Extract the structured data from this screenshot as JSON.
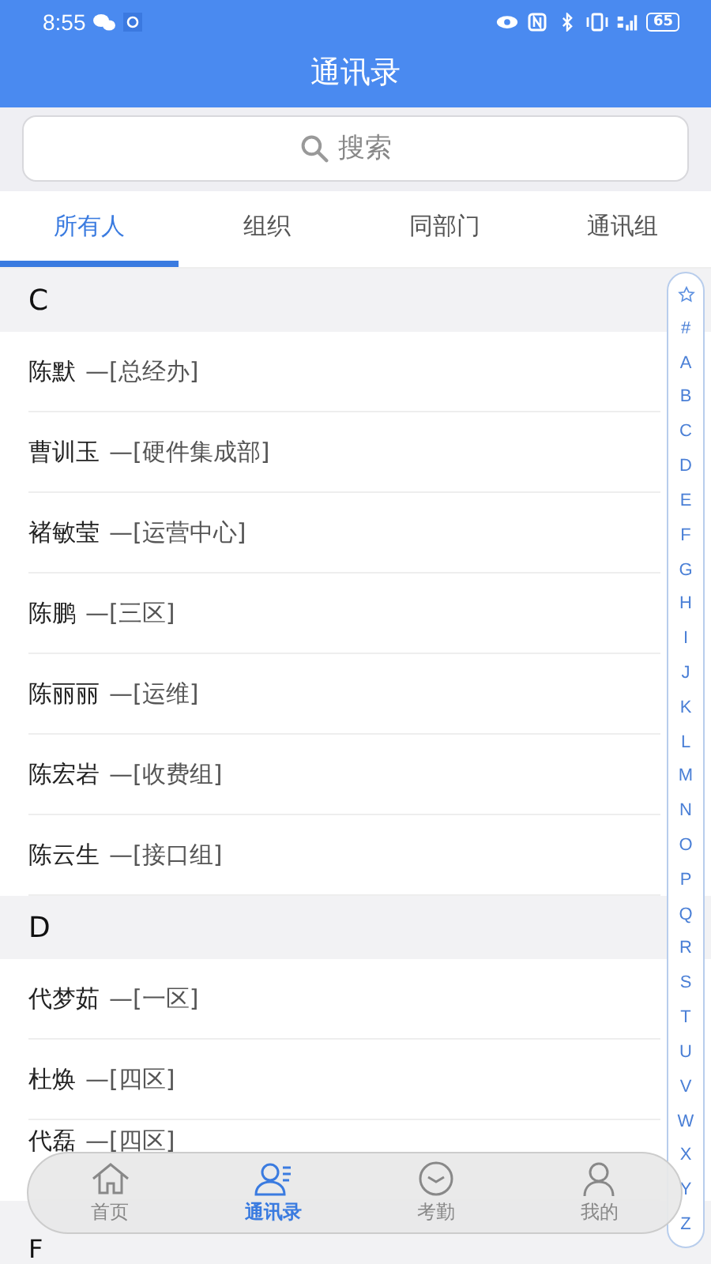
{
  "status_bar": {
    "time": "8:55",
    "battery": "65"
  },
  "header": {
    "title": "通讯录"
  },
  "search": {
    "placeholder": "搜索"
  },
  "tabs": [
    {
      "label": "所有人",
      "selected": true
    },
    {
      "label": "组织",
      "selected": false
    },
    {
      "label": "同部门",
      "selected": false
    },
    {
      "label": "通讯组",
      "selected": false
    }
  ],
  "sections": [
    {
      "letter": "C",
      "contacts": [
        {
          "name": "陈默",
          "dept": "—[总经办]"
        },
        {
          "name": "曹训玉",
          "dept": "—[硬件集成部]"
        },
        {
          "name": "褚敏莹",
          "dept": "—[运营中心]"
        },
        {
          "name": "陈鹏",
          "dept": "—[三区]"
        },
        {
          "name": "陈丽丽",
          "dept": "—[运维]"
        },
        {
          "name": "陈宏岩",
          "dept": "—[收费组]"
        },
        {
          "name": "陈云生",
          "dept": "—[接口组]"
        }
      ]
    },
    {
      "letter": "D",
      "contacts": [
        {
          "name": "代梦茹",
          "dept": "—[一区]"
        },
        {
          "name": "杜焕",
          "dept": "—[四区]"
        },
        {
          "name": "代磊",
          "dept": "—[四区]"
        }
      ]
    },
    {
      "letter": "F"
    }
  ],
  "index": [
    "#",
    "A",
    "B",
    "C",
    "D",
    "E",
    "F",
    "G",
    "H",
    "I",
    "J",
    "K",
    "L",
    "M",
    "N",
    "O",
    "P",
    "Q",
    "R",
    "S",
    "T",
    "U",
    "V",
    "W",
    "X",
    "Y",
    "Z"
  ],
  "nav": [
    {
      "label": "首页",
      "kind": "home",
      "selected": false
    },
    {
      "label": "通讯录",
      "kind": "contacts",
      "selected": true
    },
    {
      "label": "考勤",
      "kind": "clock",
      "selected": false
    },
    {
      "label": "我的",
      "kind": "person",
      "selected": false
    }
  ]
}
